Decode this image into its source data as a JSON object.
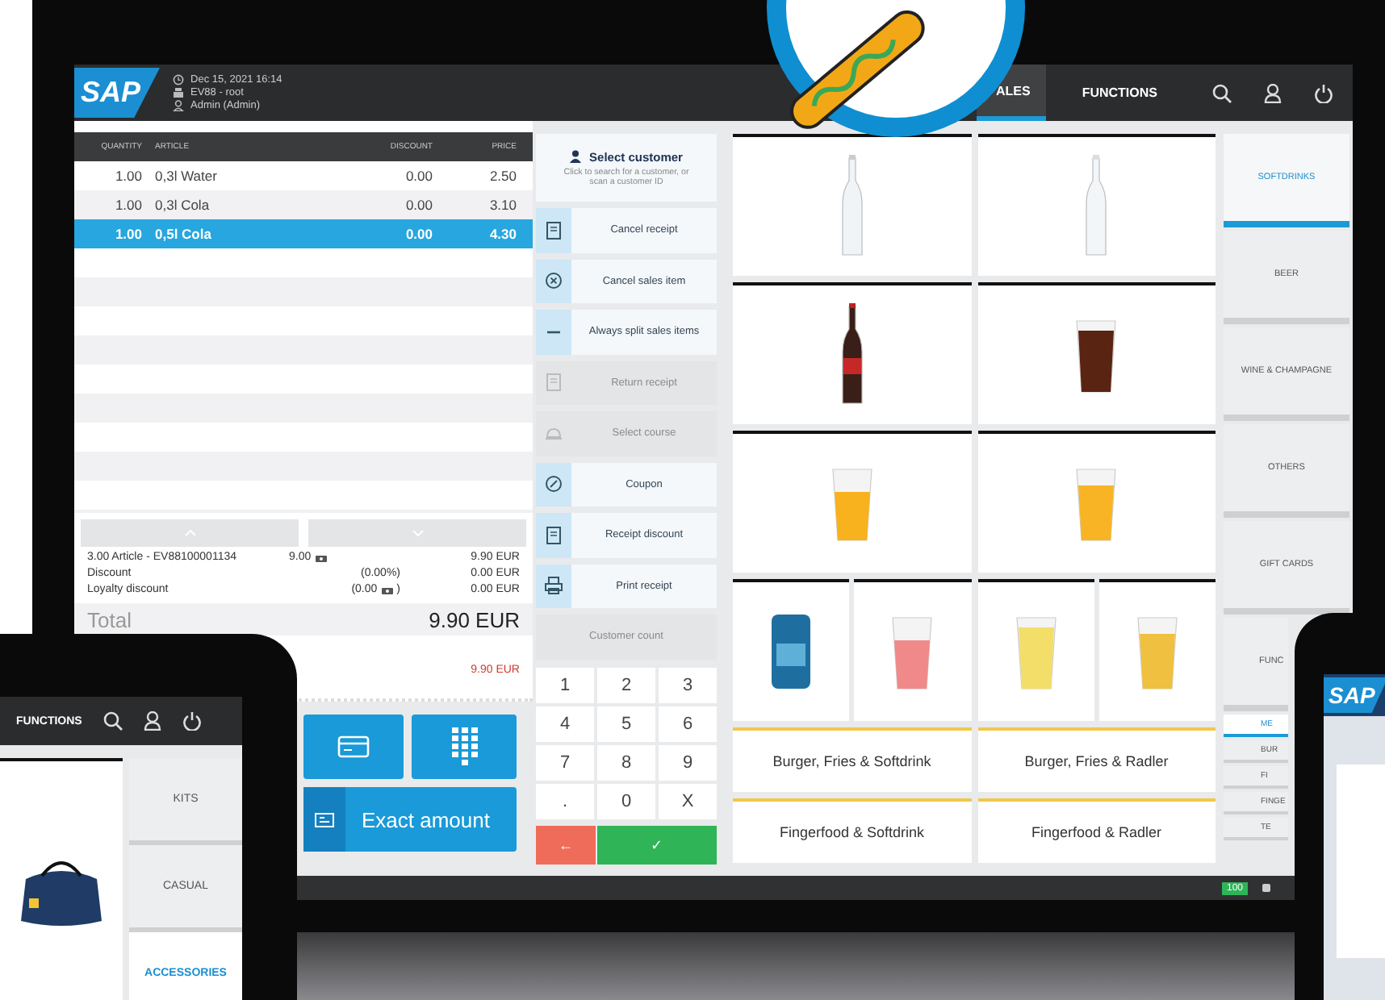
{
  "laptop": {
    "header": {
      "logo": "SAP",
      "info": [
        "Dec 15, 2021 16:14",
        "EV88 - root",
        "Admin (Admin)"
      ],
      "tabs": [
        {
          "label": "ALES",
          "selected": true
        },
        {
          "label": "FUNCTIONS",
          "selected": false
        }
      ]
    },
    "receipt": {
      "columns": [
        "QUANTITY",
        "ARTICLE",
        "DISCOUNT",
        "PRICE"
      ],
      "rows": [
        {
          "quantity": "1.00",
          "article": "0,3l Water",
          "discount": "0.00",
          "price": "2.50",
          "selected": false
        },
        {
          "quantity": "1.00",
          "article": "0,3l Cola",
          "discount": "0.00",
          "price": "3.10",
          "selected": false
        },
        {
          "quantity": "1.00",
          "article": "0,5l Cola",
          "discount": "0.00",
          "price": "4.30",
          "selected": true
        }
      ],
      "summary": [
        {
          "label": "3.00 Article - EV88100001134",
          "detail": "9.00",
          "currency_icon": true,
          "amount": "9.90 EUR"
        },
        {
          "label": "Discount",
          "detail": "(0.00%)",
          "currency_icon": false,
          "amount": "0.00 EUR"
        },
        {
          "label": "Loyalty discount",
          "detail": "(0.00",
          "currency_icon": true,
          "detail_end": ")",
          "amount": "0.00 EUR"
        }
      ],
      "total": {
        "label": "Total",
        "amount": "9.90 EUR"
      },
      "due": "9.90 EUR",
      "exact_amount": "Exact amount"
    },
    "customer": {
      "title": "Select customer",
      "hint": "Click to search for a customer, or scan a customer ID"
    },
    "actions": [
      {
        "label": "Cancel receipt",
        "disabled": false
      },
      {
        "label": "Cancel sales item",
        "disabled": false
      },
      {
        "label": "Always split sales items",
        "disabled": false
      },
      {
        "label": "Return receipt",
        "disabled": true
      },
      {
        "label": "Select course",
        "disabled": true
      },
      {
        "label": "Coupon",
        "disabled": false
      },
      {
        "label": "Receipt discount",
        "disabled": false
      },
      {
        "label": "Print receipt",
        "disabled": false
      },
      {
        "label": "Customer count",
        "disabled": true
      }
    ],
    "keypad": [
      "1",
      "2",
      "3",
      "4",
      "5",
      "6",
      "7",
      "8",
      "9",
      ".",
      "0",
      "X"
    ],
    "back_key": "←",
    "ok_key": "✓",
    "combos": [
      "Burger, Fries & Softdrink",
      "Burger, Fries & Radler",
      "Fingerfood & Softdrink",
      "Fingerfood & Radler"
    ],
    "categories": [
      {
        "label": "SOFTDRINKS",
        "selected": true
      },
      {
        "label": "BEER",
        "selected": false
      },
      {
        "label": "WINE & CHAMPAGNE",
        "selected": false
      },
      {
        "label": "OTHERS",
        "selected": false
      },
      {
        "label": "GIFT CARDS",
        "selected": false
      },
      {
        "label": "FUNC",
        "selected": false
      }
    ],
    "subcategories": [
      {
        "label": "ME",
        "selected": true
      },
      {
        "label": "BUR",
        "selected": false
      },
      {
        "label": "FI",
        "selected": false
      },
      {
        "label": "FINGE",
        "selected": false
      },
      {
        "label": "TE",
        "selected": false
      }
    ],
    "status_bar": {
      "badge": "100"
    }
  },
  "left_tablet": {
    "tab": "FUNCTIONS",
    "categories": [
      {
        "label": "KITS",
        "selected": false
      },
      {
        "label": "CASUAL",
        "selected": false
      },
      {
        "label": "ACCESSORIES",
        "selected": true
      }
    ]
  },
  "right_tablet": {
    "logo": "SAP"
  }
}
